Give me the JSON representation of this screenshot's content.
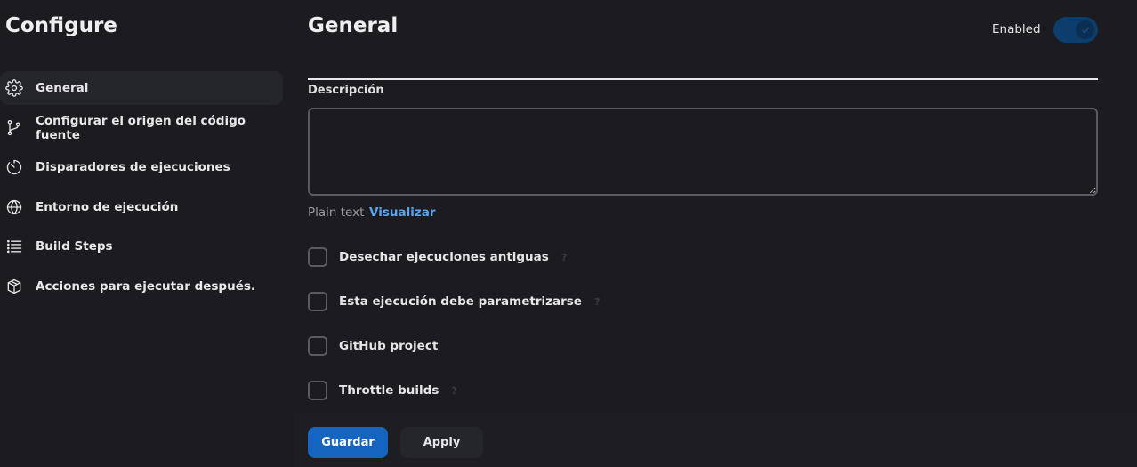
{
  "sidebar": {
    "title": "Configure",
    "items": [
      {
        "label": "General",
        "icon": "gear-icon",
        "active": true
      },
      {
        "label": "Configurar el origen del código fuente",
        "icon": "git-branch-icon"
      },
      {
        "label": "Disparadores de ejecuciones",
        "icon": "timer-icon"
      },
      {
        "label": "Entorno de ejecución",
        "icon": "globe-icon"
      },
      {
        "label": "Build Steps",
        "icon": "list-icon"
      },
      {
        "label": "Acciones para ejecutar después.",
        "icon": "package-icon"
      }
    ]
  },
  "main": {
    "title": "General",
    "enabled_label": "Enabled",
    "enabled": true,
    "description_label": "Descripción",
    "description_value": "",
    "plain_text_label": "Plain text",
    "preview_link": "Visualizar",
    "options": [
      {
        "label": "Desechar ejecuciones antiguas",
        "checked": false,
        "help": "?"
      },
      {
        "label": "Esta ejecución debe parametrizarse",
        "checked": false,
        "help": "?"
      },
      {
        "label": "GitHub project",
        "checked": false
      },
      {
        "label": "Throttle builds",
        "checked": false,
        "help": "?"
      }
    ]
  },
  "actions": {
    "save_label": "Guardar",
    "apply_label": "Apply"
  },
  "colors": {
    "background": "#1c1c20",
    "accent": "#1565c0",
    "link": "#5aa7f0",
    "toggle_on": "#0d3d6b"
  }
}
